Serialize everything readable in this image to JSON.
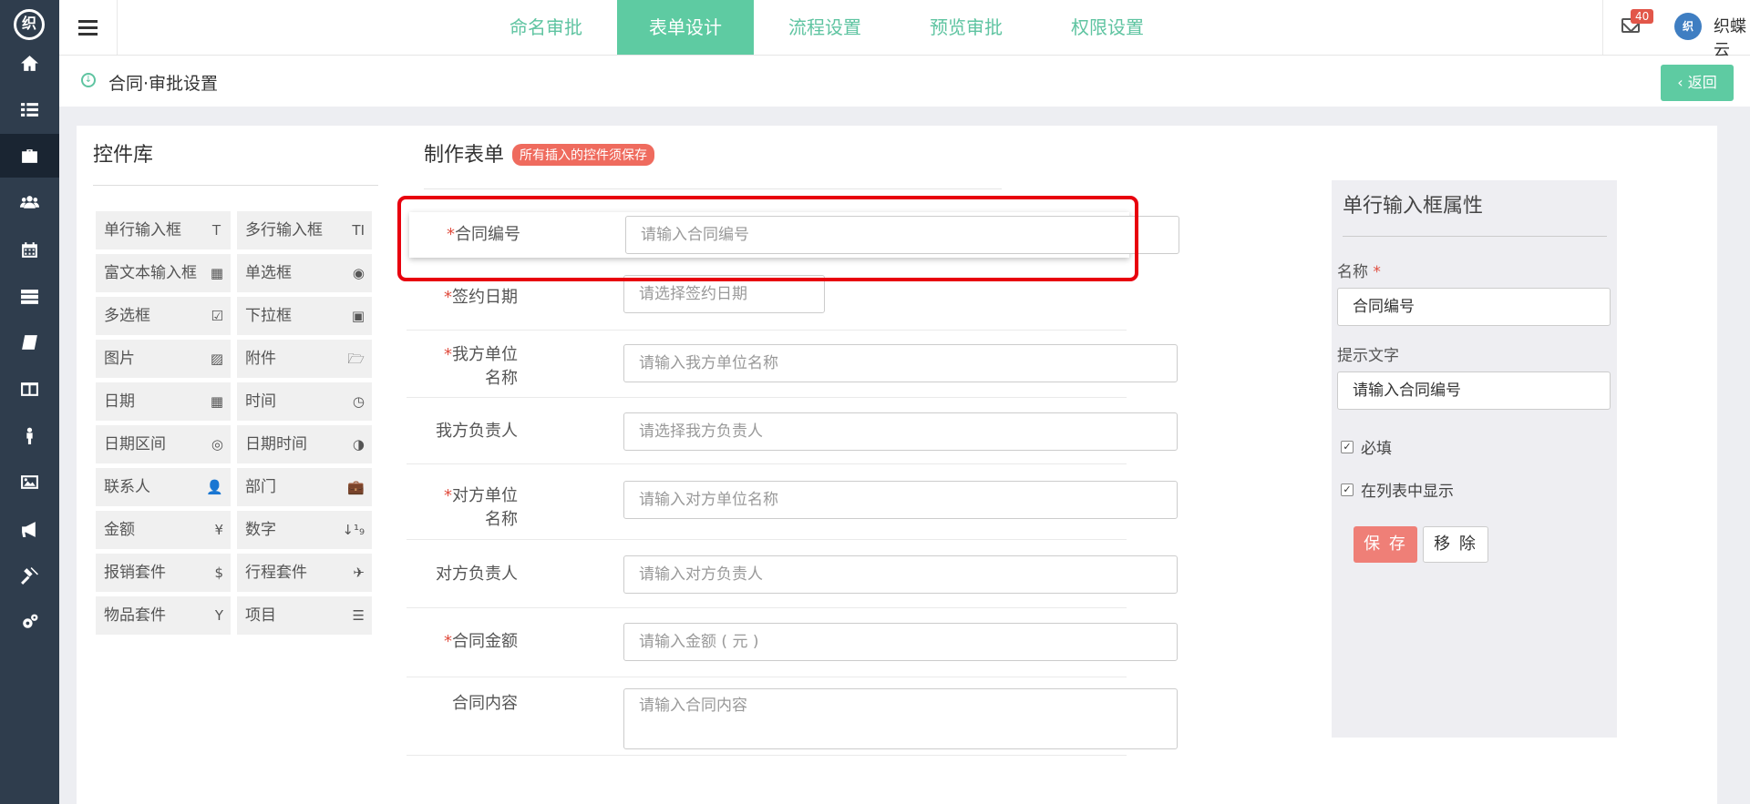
{
  "app": {
    "logo_text": "织"
  },
  "topnav": {
    "tabs": [
      {
        "label": "命名审批"
      },
      {
        "label": "表单设计"
      },
      {
        "label": "流程设置"
      },
      {
        "label": "预览审批"
      },
      {
        "label": "权限设置"
      }
    ],
    "active_tab": 1,
    "mail_badge": "40",
    "avatar_text": "织",
    "user_name": "织蝶云"
  },
  "breadcrumb": {
    "title": "合同·审批设置",
    "back_label": "返回"
  },
  "sidebar": {
    "icons": [
      "home-icon",
      "list-icon",
      "briefcase-icon",
      "users-icon",
      "calendar-icon",
      "server-icon",
      "book-icon",
      "columns-icon",
      "person-icon",
      "image-icon",
      "bullhorn-icon",
      "gavel-icon",
      "cogs-icon"
    ],
    "active_index": 2
  },
  "library": {
    "title": "控件库",
    "items": [
      {
        "label": "单行输入框",
        "icon": "Ｔ"
      },
      {
        "label": "多行输入框",
        "icon": "TI"
      },
      {
        "label": "富文本输入框",
        "icon": "▦"
      },
      {
        "label": "单选框",
        "icon": "◉"
      },
      {
        "label": "多选框",
        "icon": "☑"
      },
      {
        "label": "下拉框",
        "icon": "▣"
      },
      {
        "label": "图片",
        "icon": "▨"
      },
      {
        "label": "附件",
        "icon": "🗁"
      },
      {
        "label": "日期",
        "icon": "▦"
      },
      {
        "label": "时间",
        "icon": "◷"
      },
      {
        "label": "日期区间",
        "icon": "◎"
      },
      {
        "label": "日期时间",
        "icon": "◑"
      },
      {
        "label": "联系人",
        "icon": "👤"
      },
      {
        "label": "部门",
        "icon": "💼"
      },
      {
        "label": "金额",
        "icon": "¥"
      },
      {
        "label": "数字",
        "icon": "↓¹₉"
      },
      {
        "label": "报销套件",
        "icon": "$"
      },
      {
        "label": "行程套件",
        "icon": "✈"
      },
      {
        "label": "物品套件",
        "icon": "Y"
      },
      {
        "label": "项目",
        "icon": "☰"
      }
    ]
  },
  "form": {
    "title": "制作表单",
    "tag": "所有插入的控件须保存",
    "fields": [
      {
        "label": "合同编号",
        "required": true,
        "placeholder": "请输入合同编号"
      },
      {
        "label": "签约日期",
        "required": true,
        "placeholder": "请选择签约日期"
      },
      {
        "label_lines": [
          "我方单位",
          "名称"
        ],
        "required": true,
        "placeholder": "请输入我方单位名称"
      },
      {
        "label": "我方负责人",
        "required": false,
        "placeholder": "请选择我方负责人"
      },
      {
        "label_lines": [
          "对方单位",
          "名称"
        ],
        "required": true,
        "placeholder": "请输入对方单位名称"
      },
      {
        "label": "对方负责人",
        "required": false,
        "placeholder": "请输入对方负责人"
      },
      {
        "label": "合同金额",
        "required": true,
        "placeholder": "请输入金额 ( 元 )"
      },
      {
        "label": "合同内容",
        "required": false,
        "placeholder": "请输入合同内容"
      }
    ]
  },
  "properties": {
    "title": "单行输入框属性",
    "name_label": "名称",
    "name_value": "合同编号",
    "hint_label": "提示文字",
    "hint_value": "请输入合同编号",
    "required_label": "必填",
    "required_checked": true,
    "show_in_list_label": "在列表中显示",
    "show_in_list_checked": true,
    "save_label": "保 存",
    "remove_label": "移 除"
  },
  "colors": {
    "accent": "#5ecba2",
    "sidebar": "#2f3d4d",
    "highlight": "#e8000e",
    "danger": "#ef6b5e"
  }
}
